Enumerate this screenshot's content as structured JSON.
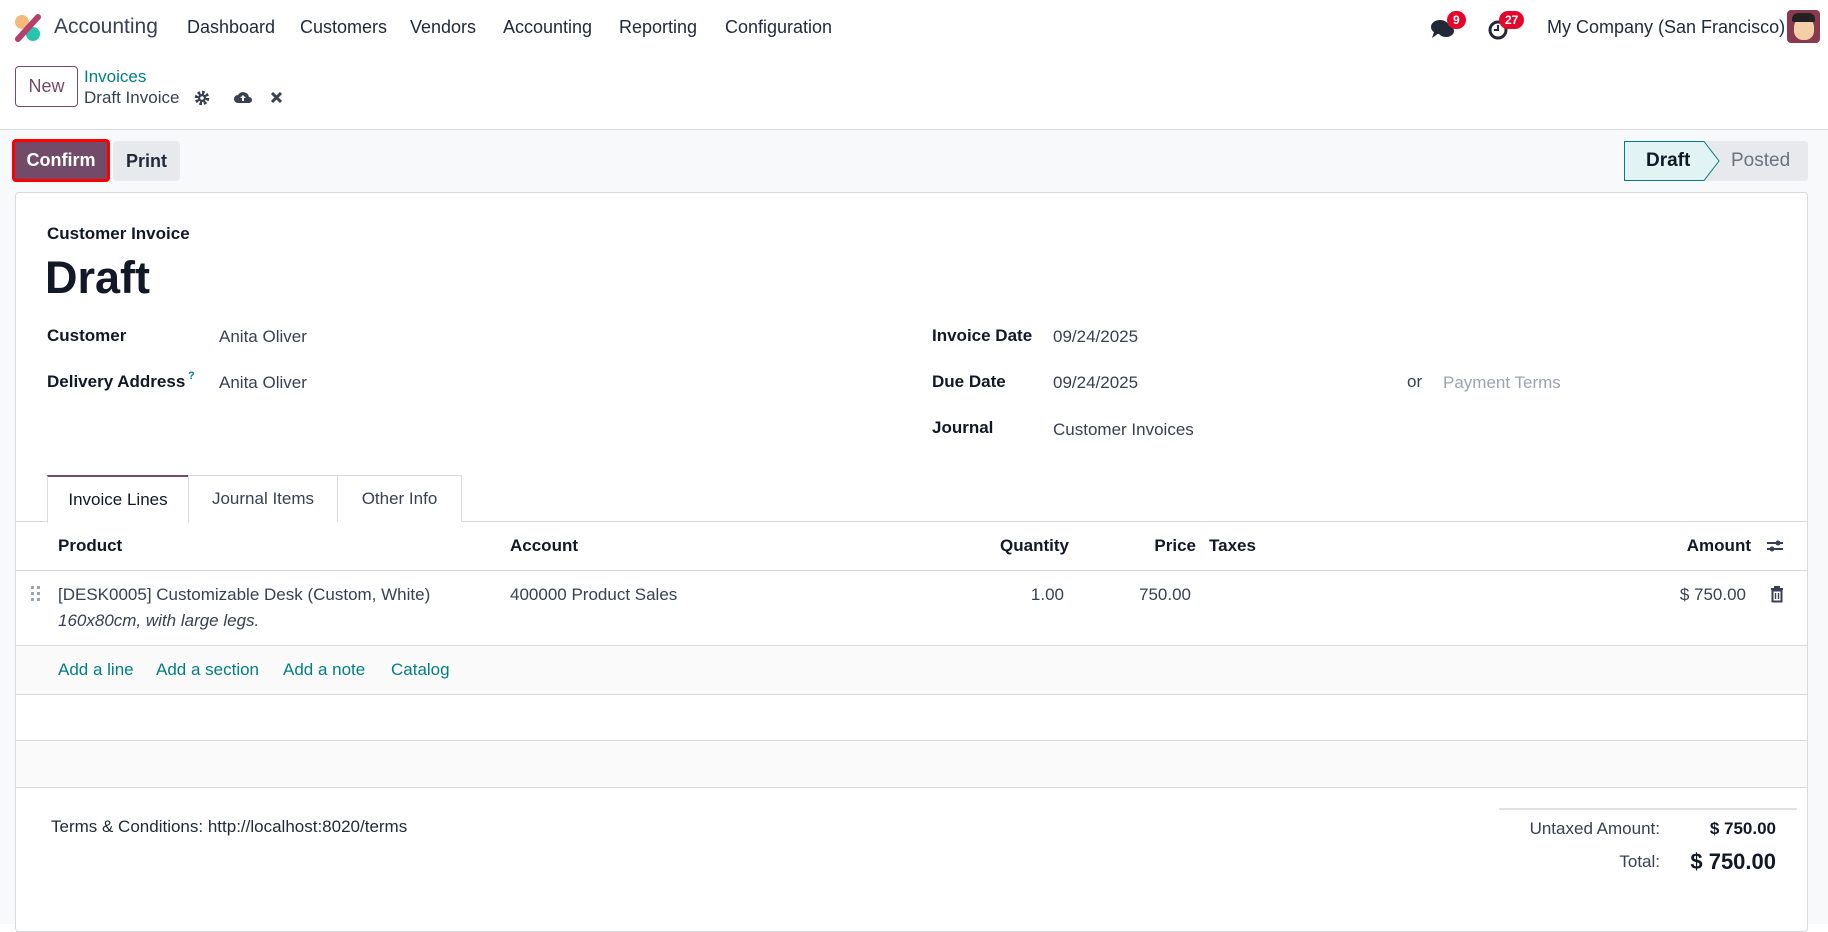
{
  "navbar": {
    "app_name": "Accounting",
    "menu": [
      "Dashboard",
      "Customers",
      "Vendors",
      "Accounting",
      "Reporting",
      "Configuration"
    ],
    "messages_badge": "9",
    "activities_badge": "27",
    "company": "My Company (San Francisco)"
  },
  "breadcrumb": {
    "new_label": "New",
    "parent": "Invoices",
    "current": "Draft Invoice"
  },
  "actions": {
    "confirm": "Confirm",
    "print": "Print"
  },
  "status": {
    "steps": [
      "Draft",
      "Posted"
    ],
    "active": "Draft"
  },
  "form": {
    "type_label": "Customer Invoice",
    "name": "Draft",
    "customer_label": "Customer",
    "customer": "Anita Oliver",
    "delivery_label": "Delivery Address",
    "delivery_help": "?",
    "delivery": "Anita Oliver",
    "invoice_date_label": "Invoice Date",
    "invoice_date": "09/24/2025",
    "due_date_label": "Due Date",
    "due_date": "09/24/2025",
    "or": "or",
    "payment_terms_placeholder": "Payment Terms",
    "journal_label": "Journal",
    "journal": "Customer Invoices"
  },
  "tabs": [
    "Invoice Lines",
    "Journal Items",
    "Other Info"
  ],
  "lines": {
    "headers": {
      "product": "Product",
      "account": "Account",
      "quantity": "Quantity",
      "price": "Price",
      "taxes": "Taxes",
      "amount": "Amount"
    },
    "rows": [
      {
        "product": "[DESK0005] Customizable Desk (Custom, White)",
        "description": "160x80cm, with large legs.",
        "account": "400000 Product Sales",
        "quantity": "1.00",
        "price": "750.00",
        "taxes": "",
        "amount": "$ 750.00"
      }
    ],
    "add_links": [
      "Add a line",
      "Add a section",
      "Add a note",
      "Catalog"
    ]
  },
  "footer": {
    "terms": "Terms & Conditions: http://localhost:8020/terms",
    "untaxed_label": "Untaxed Amount:",
    "untaxed": "$ 750.00",
    "total_label": "Total:",
    "total": "$ 750.00"
  },
  "colors": {
    "primary": "#714B67",
    "link": "#017e84",
    "badge": "#e5062c",
    "highlight": "#ff0000"
  }
}
